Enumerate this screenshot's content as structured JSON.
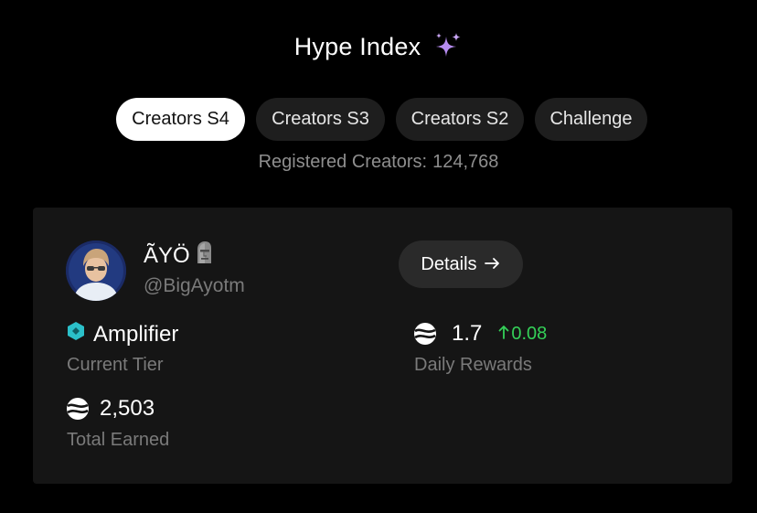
{
  "header": {
    "title": "Hype Index",
    "icon": "sparkle-icon",
    "icon_color": "#b68cf0"
  },
  "tabs": [
    {
      "label": "Creators S4",
      "active": true
    },
    {
      "label": "Creators S3",
      "active": false
    },
    {
      "label": "Creators S2",
      "active": false
    },
    {
      "label": "Challenge",
      "active": false
    }
  ],
  "registered": {
    "label": "Registered Creators:",
    "count": "124,768"
  },
  "profile": {
    "name": "ÃYÖ",
    "name_emoji": "moai-emoji",
    "handle": "@BigAyotm",
    "details_label": "Details",
    "details_icon": "arrow-right-icon"
  },
  "stats": {
    "tier": {
      "value": "Amplifier",
      "label": "Current Tier",
      "icon": "hexagon-tier-icon",
      "icon_color": "#2bc0c9"
    },
    "daily": {
      "value": "1.7",
      "change": "0.08",
      "change_color": "#34d058",
      "label": "Daily Rewards",
      "icon": "coin-swirl-icon"
    },
    "total": {
      "value": "2,503",
      "label": "Total Earned",
      "icon": "coin-swirl-icon"
    }
  }
}
